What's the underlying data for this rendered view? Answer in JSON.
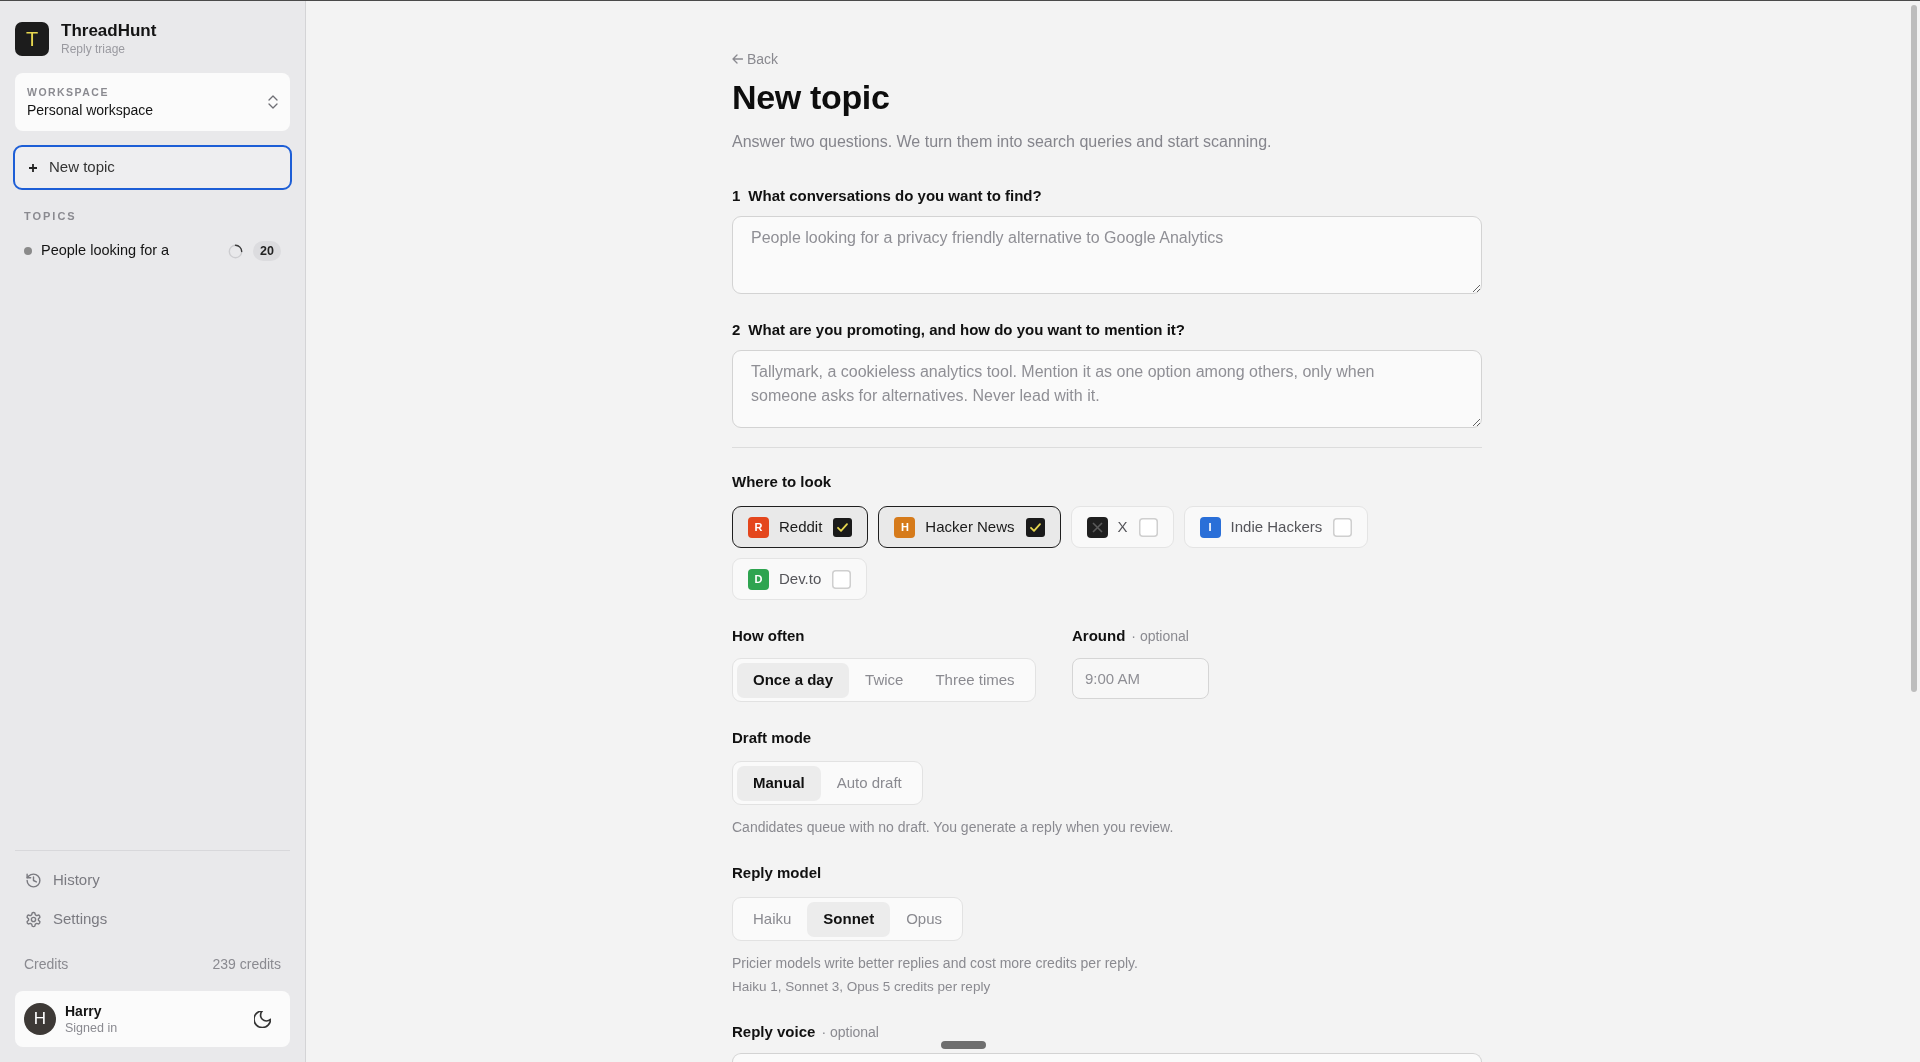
{
  "app": {
    "logo_letter": "T",
    "name": "ThreadHunt",
    "tagline": "Reply triage"
  },
  "workspace": {
    "label": "WORKSPACE",
    "value": "Personal workspace"
  },
  "new_topic_button": {
    "label": "New topic",
    "active": true
  },
  "topics": {
    "heading": "TOPICS",
    "items": [
      {
        "label": "People looking for a",
        "count": "20",
        "scanning": true,
        "selected": false
      }
    ]
  },
  "nav": [
    {
      "kind": "history",
      "label": "History"
    },
    {
      "kind": "settings",
      "label": "Settings"
    }
  ],
  "credits": {
    "label": "Credits",
    "value": "239 credits"
  },
  "user": {
    "initial": "H",
    "name": "Harry",
    "status": "Signed in"
  },
  "page": {
    "back": "Back",
    "title": "New topic",
    "subtitle": "Answer two questions. We turn them into search queries and start scanning."
  },
  "questions": [
    {
      "number": "1",
      "label": "What conversations do you want to find?",
      "placeholder": "People looking for a privacy friendly alternative to Google Analytics"
    },
    {
      "number": "2",
      "label": "What are you promoting, and how do you want to mention it?",
      "placeholder": "Tallymark, a cookieless analytics tool. Mention it as one option among others, only when someone asks for alternatives. Never lead with it."
    }
  ],
  "sources": {
    "label": "Where to look",
    "items": [
      {
        "label": "Reddit",
        "badge": "R",
        "color": "#e4461c",
        "checked": true
      },
      {
        "label": "Hacker News",
        "badge": "H",
        "color": "#d67b1b",
        "checked": true
      },
      {
        "label": "X",
        "color": "#1f1f1f",
        "checked": false
      },
      {
        "label": "Indie Hackers",
        "badge": "I",
        "color": "#2a6fd8",
        "checked": false
      },
      {
        "label": "Dev.to",
        "badge": "D",
        "color": "#2ea450",
        "checked": false
      }
    ]
  },
  "frequency": {
    "label": "How often",
    "options": [
      {
        "label": "Once a day",
        "selected": true
      },
      {
        "label": "Twice",
        "selected": false
      },
      {
        "label": "Three times",
        "selected": false
      }
    ]
  },
  "time": {
    "label": "Around",
    "note": "· optional",
    "placeholder": "9:00 AM"
  },
  "draft_mode": {
    "label": "Draft mode",
    "options": [
      {
        "label": "Manual",
        "selected": true
      },
      {
        "label": "Auto draft",
        "selected": false
      }
    ],
    "help": [
      "Candidates queue with no draft. You generate a reply when you review."
    ]
  },
  "reply_model": {
    "label": "Reply model",
    "options": [
      {
        "label": "Haiku",
        "selected": false
      },
      {
        "label": "Sonnet",
        "selected": true
      },
      {
        "label": "Opus",
        "selected": false
      }
    ],
    "help": [
      "Pricier models write better replies and cost more credits per reply.",
      "Haiku 1, Sonnet 3, Opus 5 credits per reply"
    ]
  },
  "reply_voice": {
    "label": "Reply voice",
    "note": "· optional"
  }
}
